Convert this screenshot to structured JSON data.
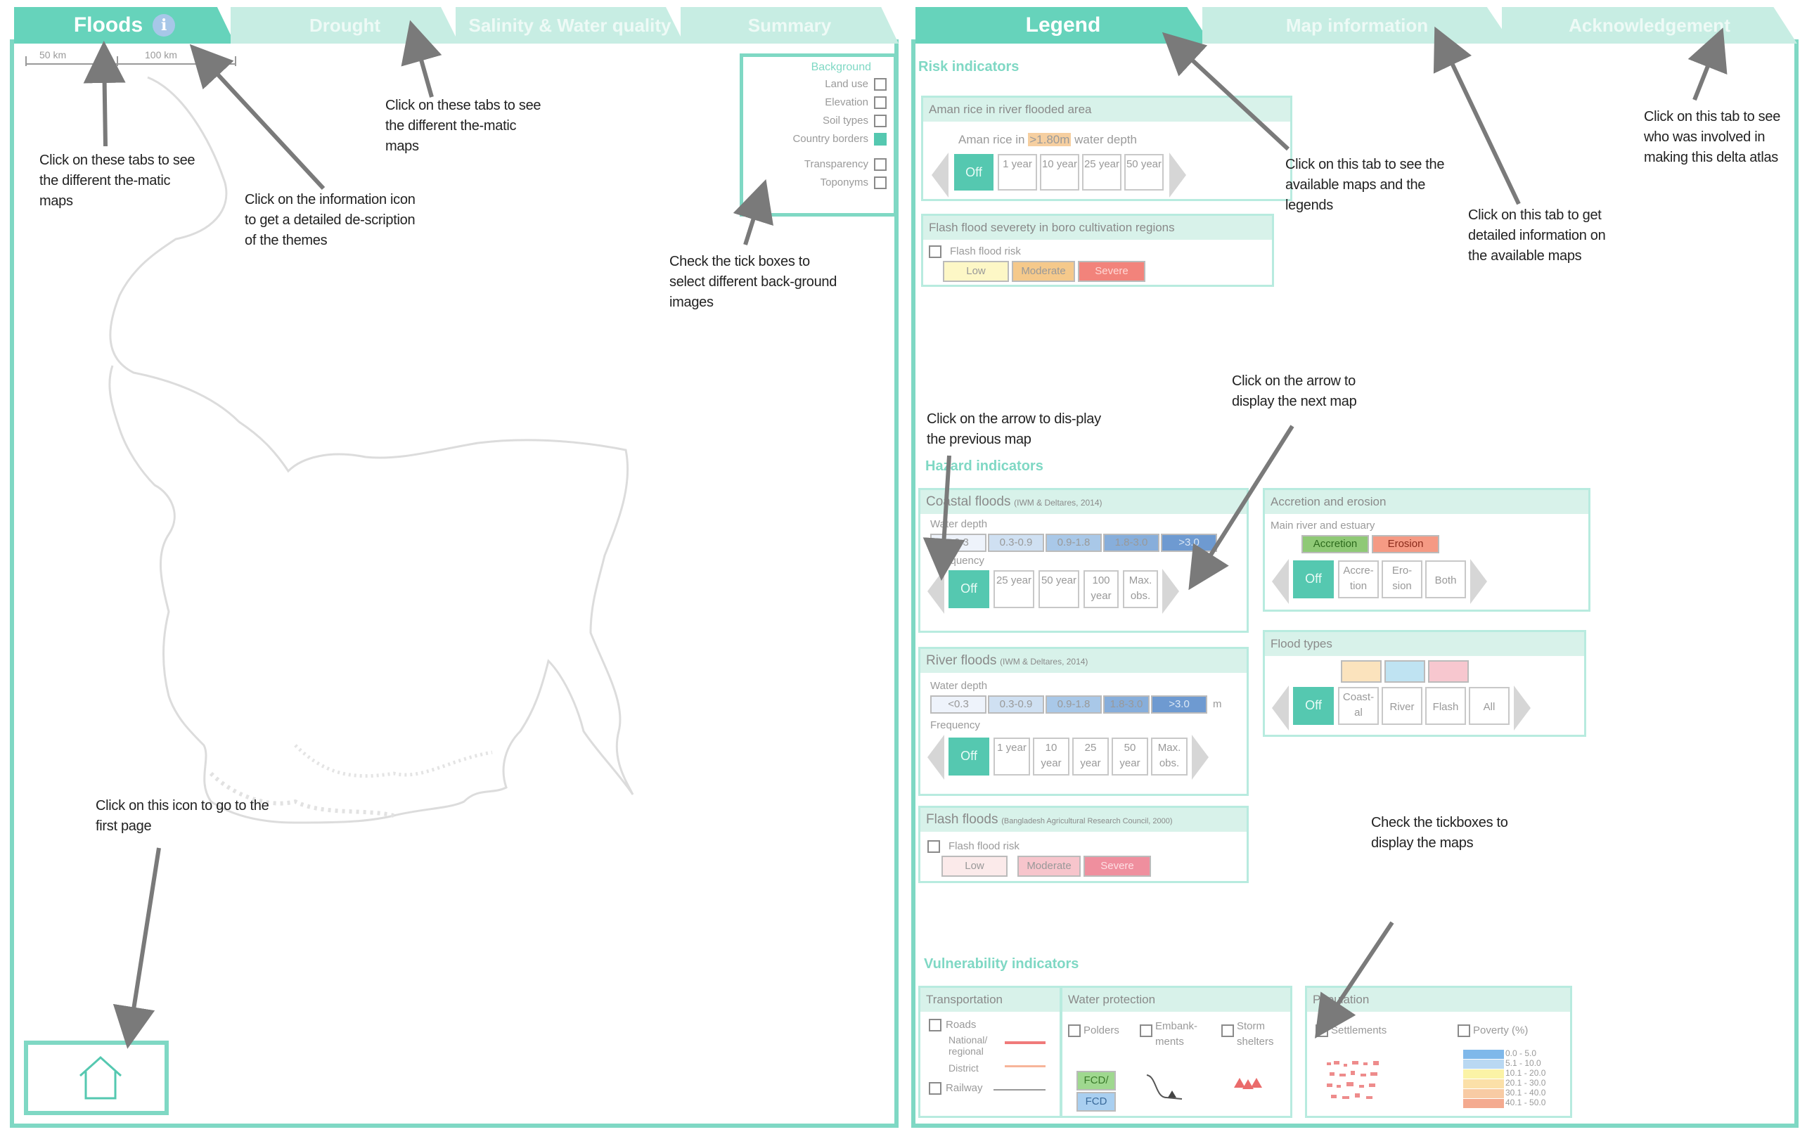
{
  "left_tabs": [
    {
      "label": "Floods",
      "active": true
    },
    {
      "label": "Drought",
      "active": false
    },
    {
      "label": "Salinity & Water quality",
      "active": false
    },
    {
      "label": "Summary",
      "active": false
    }
  ],
  "right_tabs": [
    {
      "label": "Legend",
      "active": true
    },
    {
      "label": "Map information",
      "active": false
    },
    {
      "label": "Acknowledgement",
      "active": false
    }
  ],
  "info_icon": "i",
  "scale": {
    "a": "50 km",
    "b": "100 km"
  },
  "background": {
    "title": "Background",
    "items": [
      {
        "label": "Land use",
        "checked": false
      },
      {
        "label": "Elevation",
        "checked": false
      },
      {
        "label": "Soil types",
        "checked": false
      },
      {
        "label": "Country borders",
        "checked": true
      },
      {
        "label": "Transparency",
        "checked": false
      },
      {
        "label": "Toponyms",
        "checked": false
      }
    ]
  },
  "annotations": {
    "tabs_left": "Click on these tabs to see the different the-matic maps",
    "info": "Click on the information icon to get a detailed de-scription of the themes",
    "tabs_mid": "Click on these tabs to see the different the-matic maps",
    "tickboxes_bg": "Check the tick boxes to select different back-ground images",
    "home": "Click on this icon to go to the first page",
    "legend_tab": "Click on this tab to see the available maps and the legends",
    "map_info": "Click on this tab to get detailed information on the available maps",
    "ack": "Click on this tab to see who was involved in making this delta atlas",
    "next": "Click on the arrow to display the next map",
    "prev": "Click on the arrow to dis-play the previous map",
    "tickboxes_maps": "Check the tickboxes to display the maps"
  },
  "sections": {
    "risk": "Risk indicators",
    "hazard": "Hazard indicators",
    "vulnerability": "Vulnerability indicators"
  },
  "aman": {
    "title": "Aman rice in river flooded area",
    "subtitle_a": "Aman rice in",
    "subtitle_hl": ">1.80m",
    "subtitle_b": "water depth",
    "off": "Off",
    "buttons": [
      "1 year",
      "10 year",
      "25 year",
      "50 year"
    ]
  },
  "flash_boro": {
    "title": "Flash flood severety in boro cultivation regions",
    "check": "Flash flood risk",
    "levels": [
      "Low",
      "Moderate",
      "Severe"
    ]
  },
  "coastal": {
    "title": "Coastal floods",
    "source": "(IWM & Deltares, 2014)",
    "depth_label": "Water depth",
    "depths": [
      "<0.3",
      "0.3-0.9",
      "0.9-1.8",
      "1.8-3.0",
      ">3.0"
    ],
    "freq_label": "Frequency",
    "off": "Off",
    "buttons": [
      "25 year",
      "50 year",
      "100 year",
      "Max. obs."
    ]
  },
  "river": {
    "title": "River floods",
    "source": "(IWM & Deltares, 2014)",
    "depth_label": "Water depth",
    "depths": [
      "<0.3",
      "0.3-0.9",
      "0.9-1.8",
      "1.8-3.0",
      ">3.0"
    ],
    "unit": "m",
    "freq_label": "Frequency",
    "off": "Off",
    "buttons": [
      "1 year",
      "10 year",
      "25 year",
      "50 year",
      "Max. obs."
    ]
  },
  "flash": {
    "title": "Flash floods",
    "source": "(Bangladesh Agricultural Research Council, 2000)",
    "check": "Flash flood risk",
    "levels": [
      "Low",
      "Moderate",
      "Severe"
    ]
  },
  "accretion": {
    "title": "Accretion and erosion",
    "sub": "Main river and estuary",
    "chips": [
      "Accretion",
      "Erosion"
    ],
    "off": "Off",
    "buttons": [
      "Accre-tion",
      "Ero-sion",
      "Both"
    ]
  },
  "flood_types": {
    "title": "Flood types",
    "off": "Off",
    "buttons": [
      "Coast-al",
      "River",
      "Flash",
      "All"
    ]
  },
  "transport": {
    "title": "Transportation",
    "roads": "Roads",
    "national": "National/ regional",
    "district": "District",
    "railway": "Railway"
  },
  "water_protection": {
    "title": "Water protection",
    "polders": "Polders",
    "embankments": "Embank-ments",
    "storm": "Storm shelters",
    "fcd": "FCD/",
    "fcdi": "FCD"
  },
  "population": {
    "title": "Population",
    "settlements": "Settlements",
    "poverty": "Poverty (%)",
    "classes": [
      "0.0 - 5.0",
      "5.1 - 10.0",
      "10.1 - 20.0",
      "20.1 - 30.0",
      "30.1 - 40.0",
      "40.1 - 50.0"
    ]
  },
  "colors": {
    "accent": "#7fd8c4",
    "tab_active": "#66d3bb",
    "off_button": "#55c8b0",
    "arrow": "#7a7a7a"
  }
}
